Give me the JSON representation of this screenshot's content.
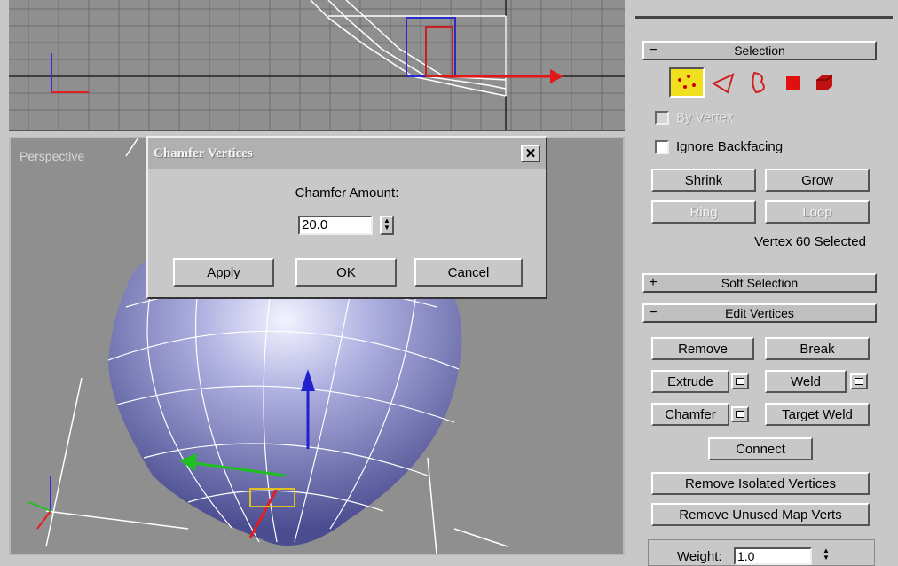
{
  "viewports": {
    "perspective_label": "Perspective"
  },
  "dialog": {
    "title": "Chamfer Vertices",
    "close_glyph": "✕",
    "amount_label": "Chamfer Amount:",
    "amount_value": "20.0",
    "apply_label": "Apply",
    "ok_label": "OK",
    "cancel_label": "Cancel"
  },
  "panel": {
    "selection": {
      "sign": "−",
      "title": "Selection",
      "by_vertex": "By Vertex",
      "ignore_backfacing": "Ignore Backfacing",
      "shrink": "Shrink",
      "grow": "Grow",
      "ring": "Ring",
      "loop": "Loop",
      "status": "Vertex 60 Selected"
    },
    "soft_selection": {
      "sign": "+",
      "title": "Soft Selection"
    },
    "edit_vertices": {
      "sign": "−",
      "title": "Edit Vertices",
      "remove": "Remove",
      "break": "Break",
      "extrude": "Extrude",
      "weld": "Weld",
      "chamfer": "Chamfer",
      "target_weld": "Target Weld",
      "connect": "Connect",
      "remove_isolated": "Remove Isolated Vertices",
      "remove_unused": "Remove Unused Map Verts",
      "weight_label": "Weight:",
      "weight_value": "1.0"
    }
  }
}
